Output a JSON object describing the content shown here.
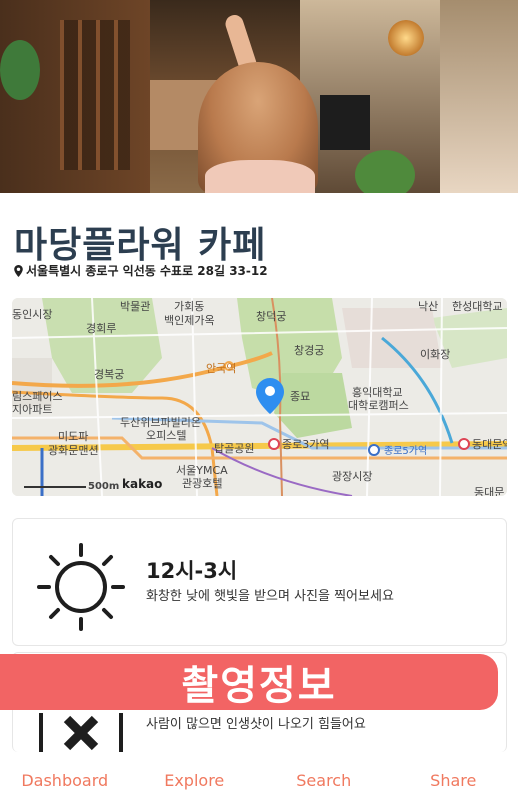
{
  "place": {
    "name": "마당플라워 카페",
    "address": "서울특별시 종로구 익선동 수표로 28길 33-12"
  },
  "map": {
    "labels": {
      "hakmungwan": "박물관",
      "donginsijang": "동인시장",
      "gahoedong": "가회동",
      "baekinjega": "백인제가옥",
      "changdeokgung": "창덕궁",
      "naksan": "낙산",
      "hanseong": "한성대학교",
      "gyeonghoeru": "경회루",
      "changgyeonggung": "창경궁",
      "ihwajang": "이화장",
      "anguk": "안국역",
      "gyeongbokgung": "경복궁",
      "jongmyo": "종묘",
      "hongik": "홍익대학교",
      "hongik2": "대학로캠퍼스",
      "limspace": "림스페이스",
      "apartment": "지아파트",
      "doosan": "두산위브파빌리온",
      "officetel": "오피스텔",
      "mido": "미도파",
      "gwanghwamun": "광화문맨션",
      "tapgol": "탑골공원",
      "jongno3": "종로3가역",
      "jongno5": "종로5가역",
      "dongdaemun": "동대문역",
      "ymca": "서울YMCA",
      "ymca2": "관광호텔",
      "gwangjang": "광장시장",
      "dongdaemun2": "동대문",
      "scale": "500m",
      "brand": "kakao"
    }
  },
  "cards": [
    {
      "icon": "sun-icon",
      "title": "12시-3시",
      "description": "화창한 낮에 햇빛을 받으며 사진을 찍어보세요"
    },
    {
      "icon": "no-crowd-icon",
      "title": "",
      "description": "사람이 많으면 인생샷이 나오기 힘들어요"
    }
  ],
  "banner": {
    "label": "촬영정보",
    "color": "#f26464"
  },
  "tabs": [
    "Dashboard",
    "Explore",
    "Search",
    "Share"
  ],
  "colors": {
    "accent": "#f0795f",
    "title": "#2c3e50",
    "pin": "#2e8ef0"
  }
}
